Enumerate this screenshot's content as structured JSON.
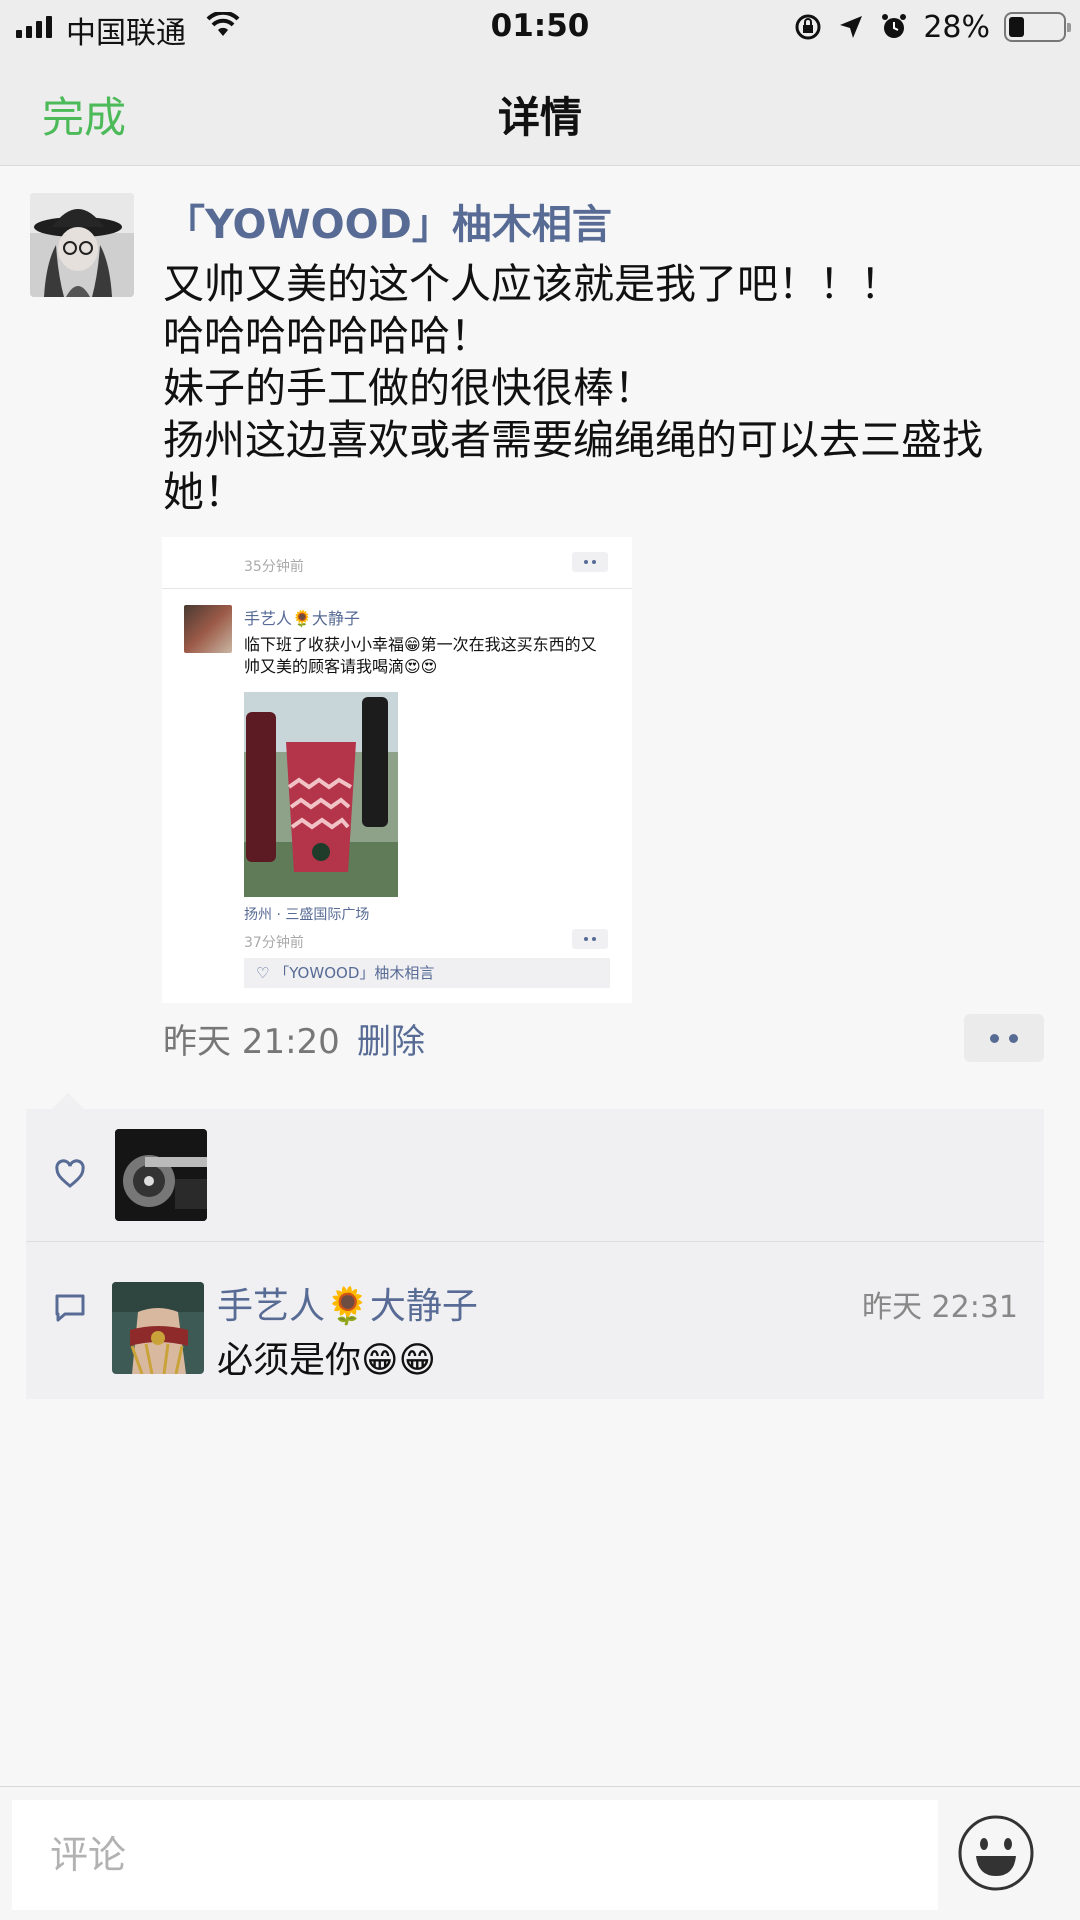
{
  "status_bar": {
    "carrier": "中国联通",
    "time": "01:50",
    "battery_percent": "28%",
    "battery_level": 0.28
  },
  "nav": {
    "done_label": "完成",
    "title": "详情"
  },
  "post": {
    "author": "「YOWOOD」柚木相言",
    "text_lines": [
      "又帅又美的这个人应该就是我了吧！！！",
      "哈哈哈哈哈哈哈！",
      "妹子的手工做的很快很棒！",
      "扬州这边喜欢或者需要编绳绳的可以去三盛找她！"
    ],
    "timestamp": "昨天 21:20",
    "delete_label": "删除",
    "screenshot": {
      "top_time": "35分钟前",
      "author": "手艺人🌻大静子",
      "text": "临下班了收获小小幸福😁第一次在我这买东西的又帅又美的顾客请我喝滴😍😍",
      "location": "扬州 · 三盛国际广场",
      "time": "37分钟前",
      "likes": "「YOWOOD」柚木相言"
    }
  },
  "comment": {
    "author": "手艺人🌻大静子",
    "time": "昨天 22:31",
    "text": "必须是你😁😁"
  },
  "input": {
    "placeholder": "评论"
  },
  "colors": {
    "link_blue": "#576b95",
    "done_green": "#4dba5a",
    "bar_bg": "#ededed"
  }
}
